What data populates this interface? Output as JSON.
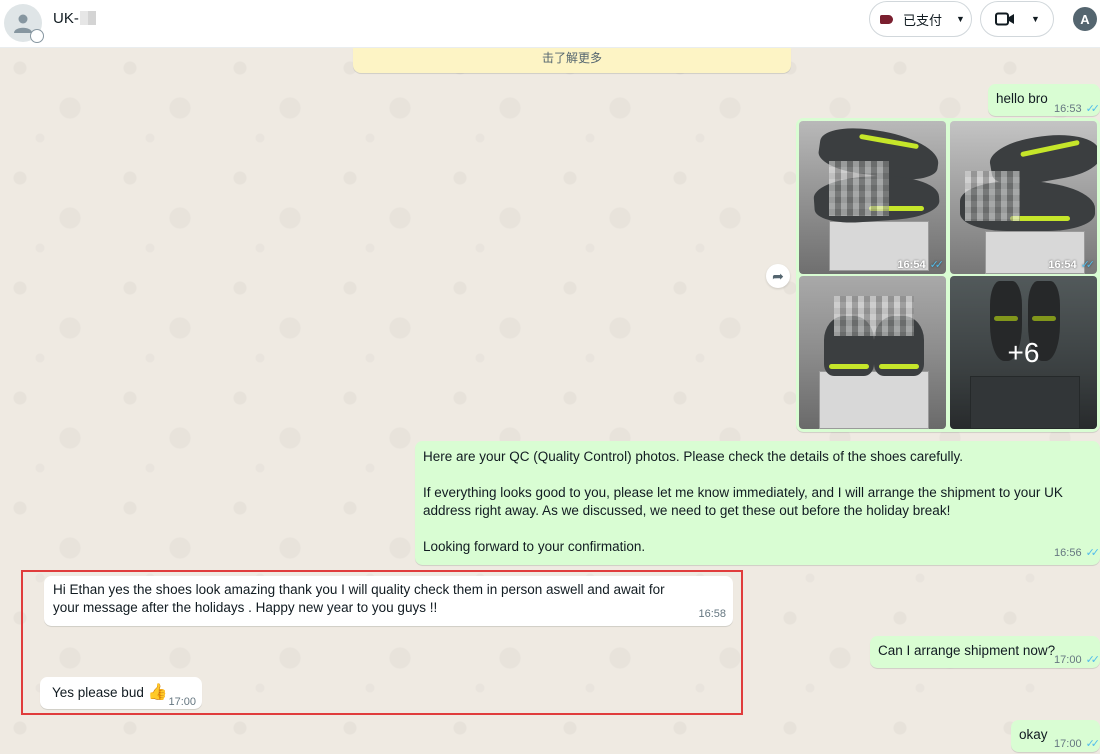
{
  "header": {
    "contact_name": "UK-",
    "label_button": "已支付",
    "translate_label": "A"
  },
  "notice": {
    "text": "击了解更多"
  },
  "messages": [
    {
      "direction": "out",
      "text": "hello bro",
      "time": "16:53",
      "ticks": "✓✓"
    },
    {
      "direction": "out",
      "type": "album",
      "photos": [
        {
          "time": "16:54",
          "ticks": "✓✓"
        },
        {
          "time": "16:54",
          "ticks": "✓✓"
        },
        {
          "time": "",
          "ticks": ""
        },
        {
          "overlay": "+6"
        }
      ]
    },
    {
      "direction": "out",
      "line1": "Here are your QC (Quality Control) photos. Please check the details of the shoes carefully.",
      "line2": "If everything looks good to you, please let me know immediately, and I will arrange the shipment to your UK address right away. As we discussed, we need to get these out before the holiday break!",
      "line3": "Looking forward to your confirmation.",
      "time": "16:56",
      "ticks": "✓✓"
    },
    {
      "direction": "in",
      "text": "Hi Ethan yes the shoes look amazing thank you I will quality check them in person aswell and await for your message after the holidays . Happy new year to you guys !!",
      "time": "16:58"
    },
    {
      "direction": "out",
      "text": "Can I arrange shipment now?",
      "time": "17:00",
      "ticks": "✓✓"
    },
    {
      "direction": "in",
      "text": "Yes please bud",
      "emoji": "👍",
      "time": "17:00"
    },
    {
      "direction": "out",
      "text": "okay",
      "time": "17:00",
      "ticks": "✓✓"
    }
  ],
  "icons": {
    "avatar": "person-icon",
    "label": "tag-icon",
    "video": "video-camera-icon",
    "forward": "forward-icon",
    "translate": "translate-icon"
  },
  "colors": {
    "outgoing_bubble": "#d9fdd3",
    "incoming_bubble": "#ffffff",
    "read_ticks": "#53bdeb",
    "highlight_border": "#e03c3c",
    "wallpaper": "#efeae2"
  }
}
